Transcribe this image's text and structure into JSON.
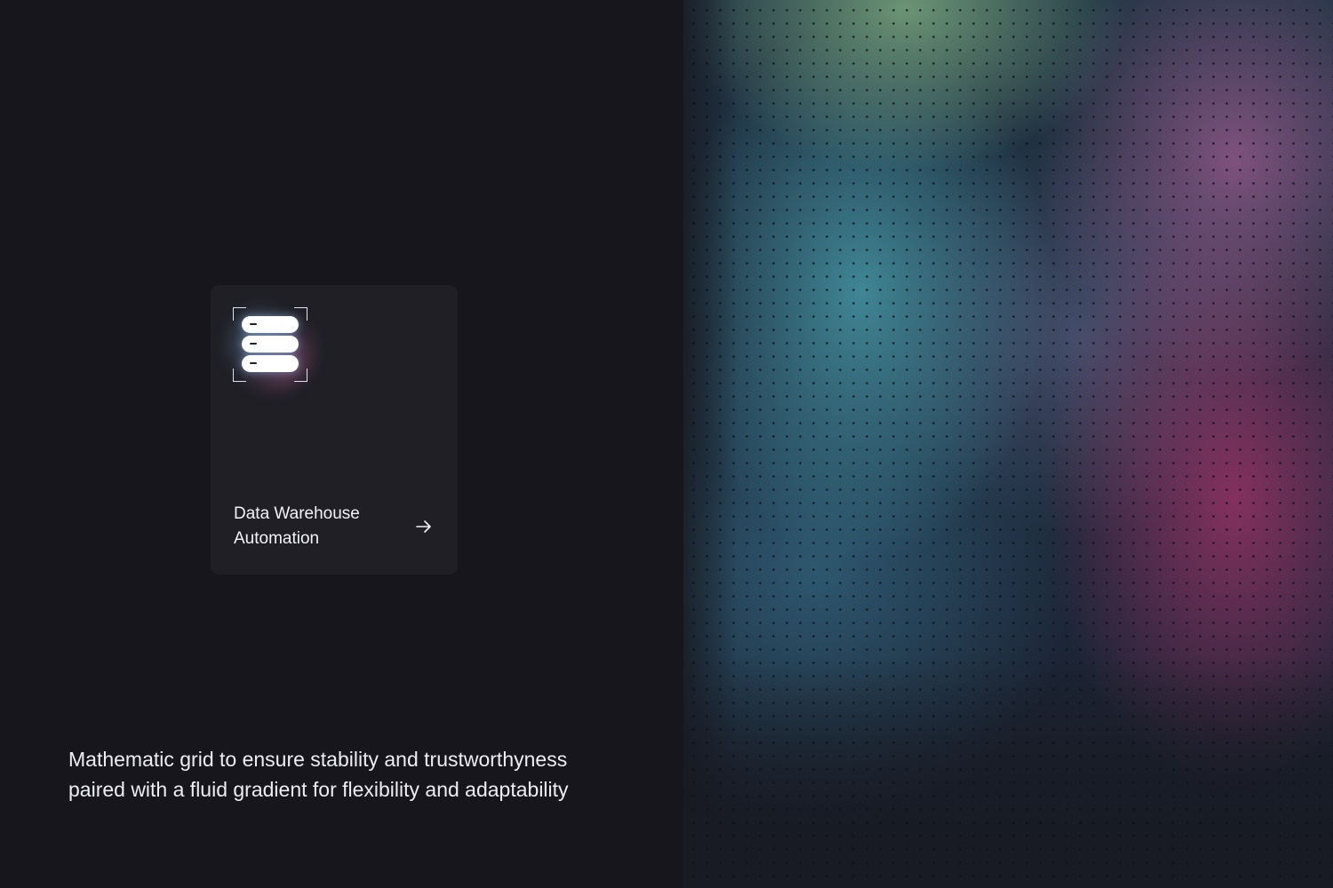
{
  "card": {
    "title": "Data Warehouse Automation",
    "icon": "database-icon",
    "arrow_icon": "arrow-right-icon"
  },
  "caption": {
    "text": "Mathematic grid to ensure stability and trustworthyness\npaired with a fluid gradient for flexibility and adaptability"
  },
  "colors": {
    "background": "#17161c",
    "card": "#1f1f25",
    "text": "#f2f3f7",
    "gradient_teal": "#4696a5",
    "gradient_green": "#78a57d",
    "gradient_magenta": "#963264"
  }
}
